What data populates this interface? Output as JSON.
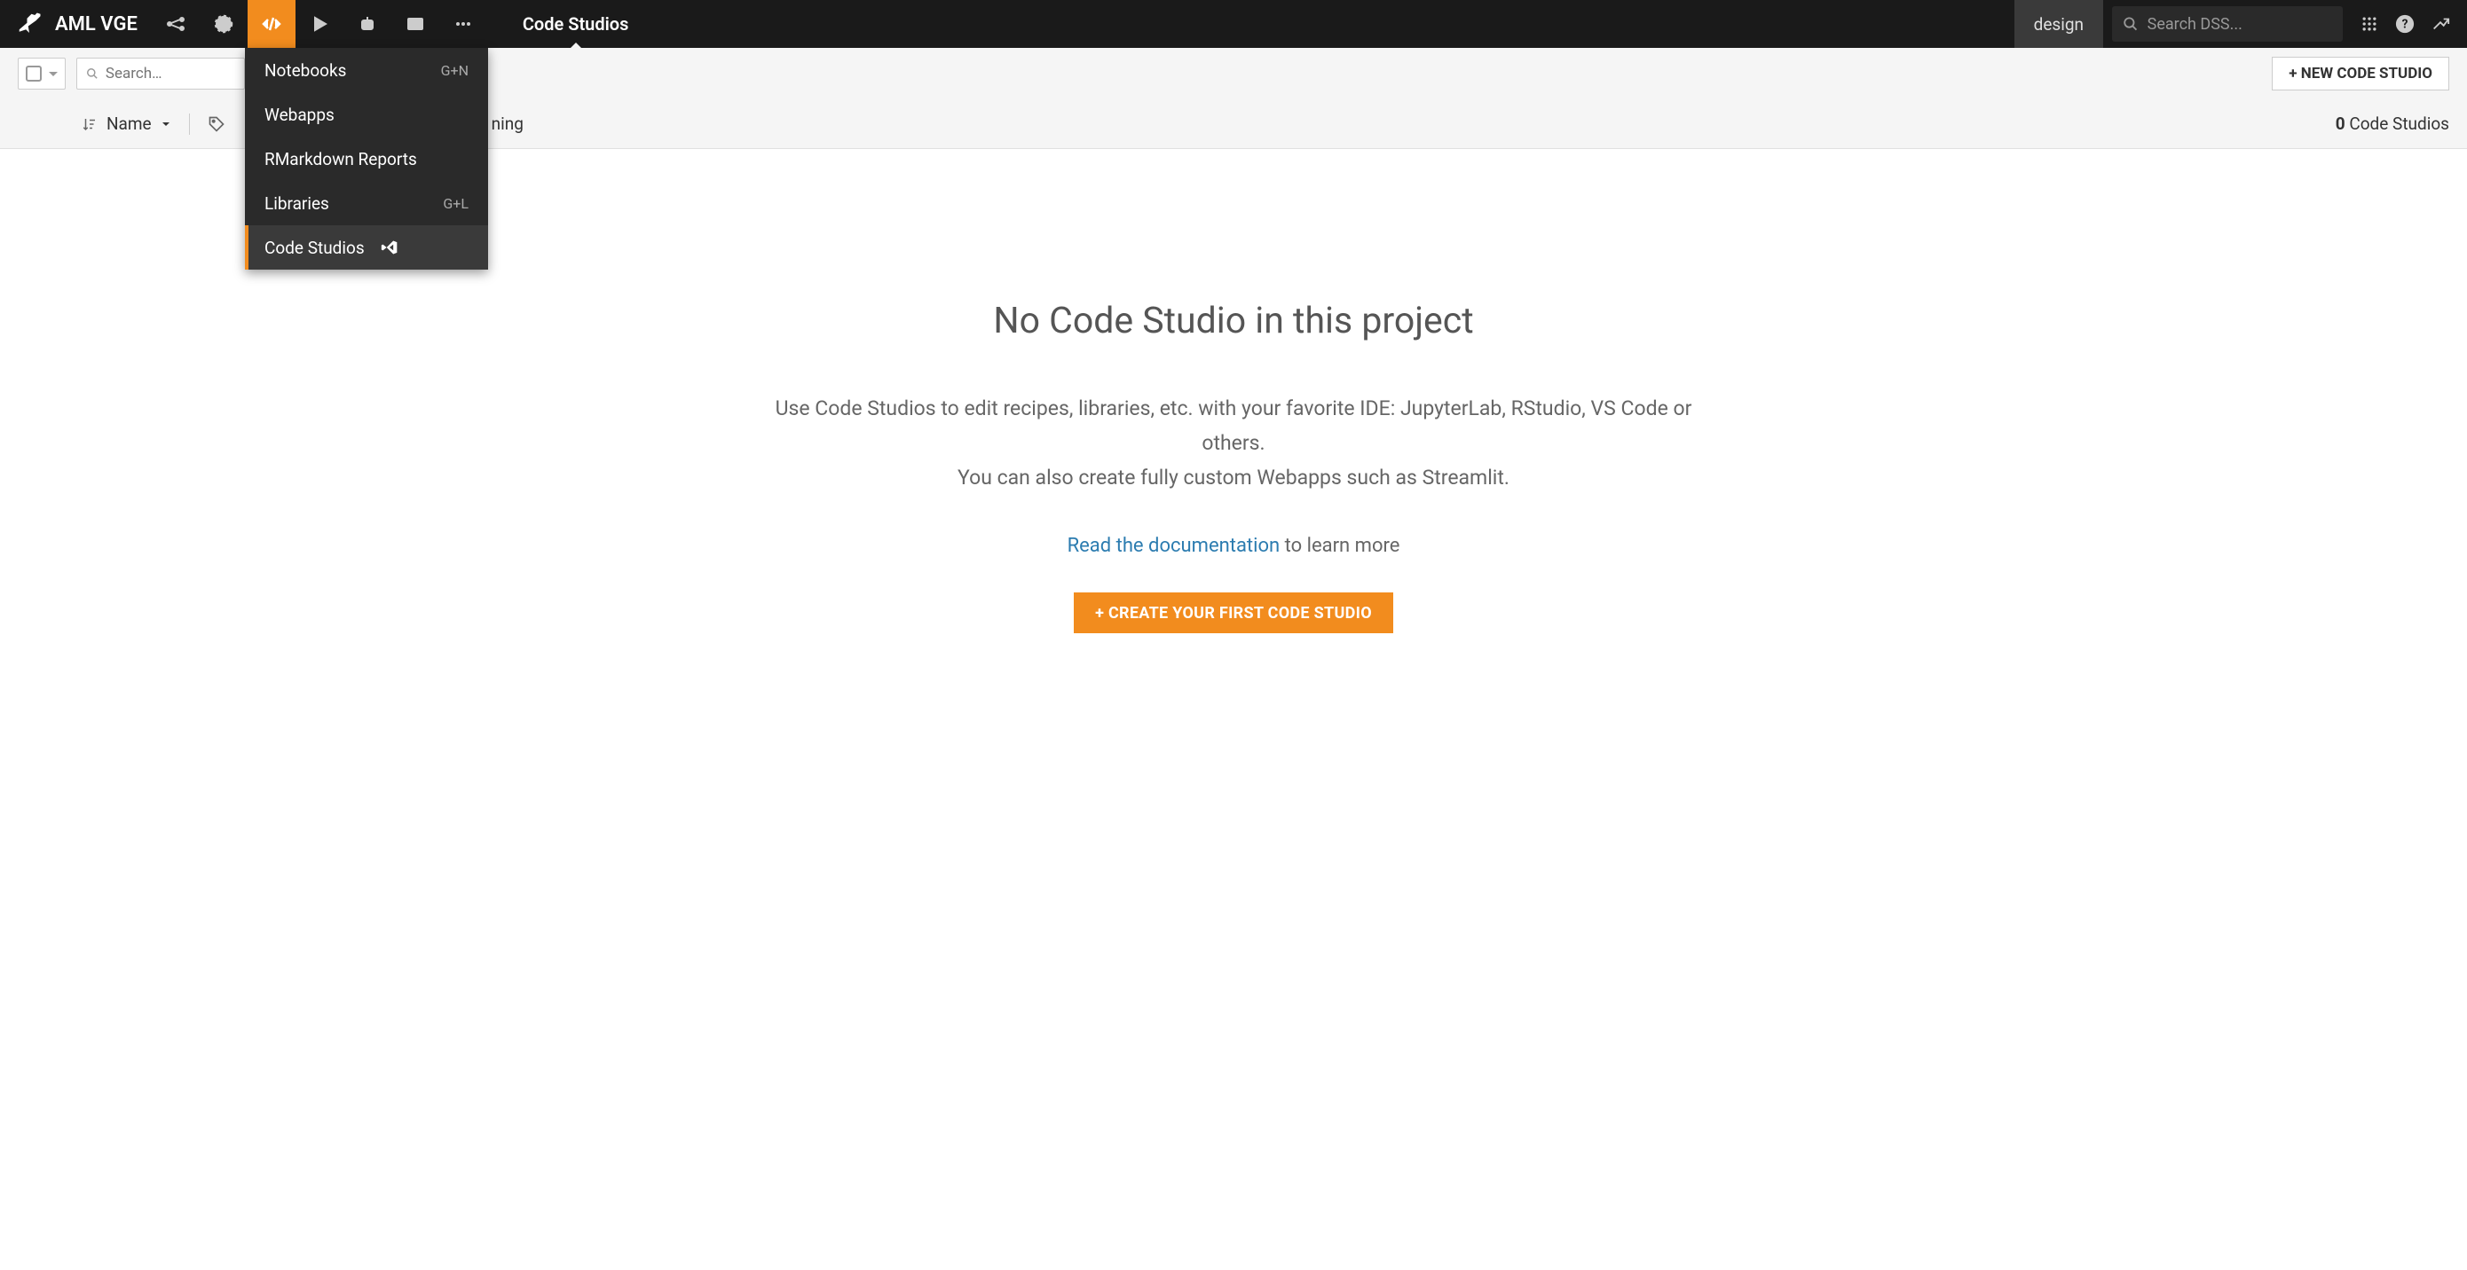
{
  "nav": {
    "project_name": "AML VGE",
    "page_title": "Code Studios",
    "design_label": "design",
    "search_placeholder": "Search DSS..."
  },
  "dropdown": {
    "items": [
      {
        "label": "Notebooks",
        "shortcut": "G+N",
        "active": false
      },
      {
        "label": "Webapps",
        "shortcut": "",
        "active": false
      },
      {
        "label": "RMarkdown Reports",
        "shortcut": "",
        "active": false
      },
      {
        "label": "Libraries",
        "shortcut": "G+L",
        "active": false
      },
      {
        "label": "Code Studios",
        "shortcut": "",
        "active": true,
        "icon": "vscode"
      }
    ]
  },
  "toolbar": {
    "search_placeholder": "Search…",
    "new_button": "+ NEW CODE STUDIO"
  },
  "filter": {
    "sort_label": "Name",
    "running_label": "ning",
    "count_number": "0",
    "count_label": " Code Studios"
  },
  "empty": {
    "title": "No Code Studio in this project",
    "desc_line1": "Use Code Studios to edit recipes, libraries, etc. with your favorite IDE: JupyterLab, RStudio, VS Code or others.",
    "desc_line2": "You can also create fully custom Webapps such as Streamlit.",
    "doc_link": "Read the documentation",
    "doc_suffix": " to learn more",
    "create_button": "+ CREATE YOUR FIRST CODE STUDIO"
  }
}
